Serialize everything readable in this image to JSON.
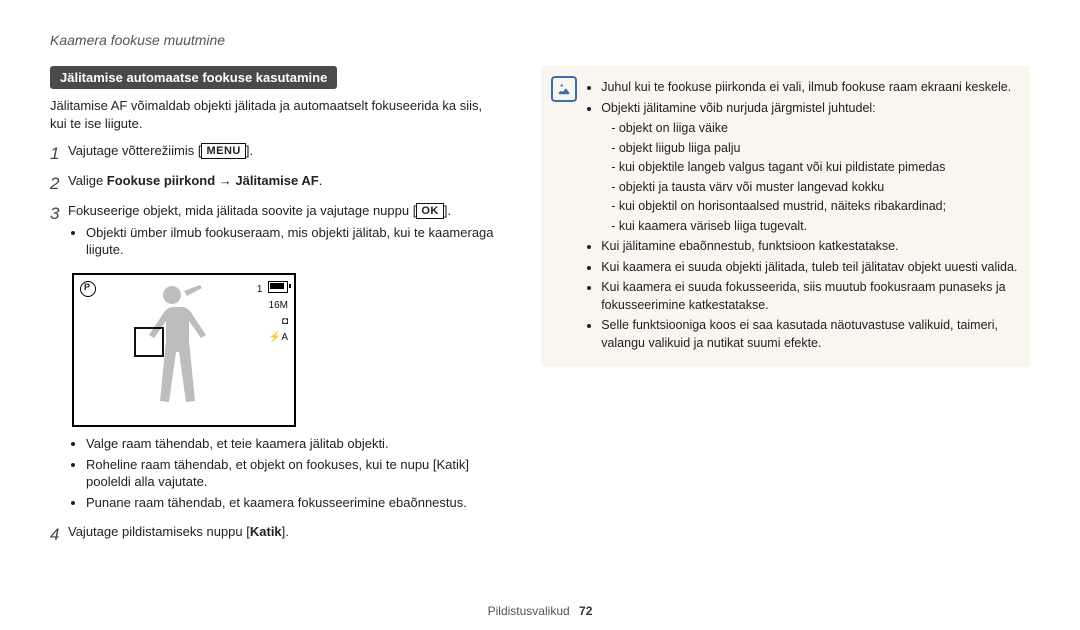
{
  "header": "Kaamera fookuse muutmine",
  "section_title": "Jälitamise automaatse fookuse kasutamine",
  "intro": "Jälitamise AF võimaldab objekti jälitada ja automaatselt fokuseerida ka siis, kui te ise liigute.",
  "steps": {
    "s1": {
      "num": "1",
      "text": "Vajutage võtterežiimis [",
      "key": "MENU",
      "after": "]."
    },
    "s2": {
      "num": "2",
      "before": "Valige ",
      "bold1": "Fookuse piirkond",
      "arrow": " → ",
      "bold2": "Jälitamise AF",
      "after": "."
    },
    "s3": {
      "num": "3",
      "text": "Fokuseerige objekt, mida jälitada soovite ja vajutage nuppu [",
      "key": "OK",
      "after": "].",
      "sub": [
        "Objekti ümber ilmub fookuseraam, mis objekti jälitab, kui te kaameraga liigute."
      ]
    },
    "s4": {
      "num": "4",
      "before": "Vajutage pildistamiseks nuppu [",
      "bold": "Katik",
      "after": "]."
    }
  },
  "screen_osd": {
    "shots": "1",
    "res": "16M",
    "icon3": "◘",
    "flash": "⚡A"
  },
  "notes_after_fig": [
    "Valge raam tähendab, et teie kaamera jälitab objekti.",
    "Roheline raam tähendab, et objekt on fookuses, kui te nupu [Katik] pooleldi alla vajutate.",
    "Punane raam tähendab, et kaamera fokusseerimine ebaõnnestus."
  ],
  "info": {
    "first": "Juhul kui te fookuse piirkonda ei vali, ilmub fookuse raam ekraani keskele.",
    "fail_intro": "Objekti jälitamine võib nurjuda järgmistel juhtudel:",
    "fail_list": [
      "objekt on liiga väike",
      "objekt liigub liiga palju",
      "kui objektile langeb valgus tagant või kui pildistate pimedas",
      "objekti ja tausta värv või muster langevad kokku",
      "kui objektil on horisontaalsed mustrid, näiteks ribakardinad;",
      "kui kaamera väriseb liiga tugevalt."
    ],
    "rest": [
      "Kui jälitamine ebaõnnestub, funktsioon katkestatakse.",
      "Kui kaamera ei suuda objekti jälitada, tuleb teil jälitatav objekt uuesti valida.",
      "Kui kaamera ei suuda fokusseerida, siis muutub fookusraam punaseks ja fokusseerimine katkestatakse.",
      "Selle funktsiooniga koos ei saa kasutada näotuvastuse valikuid, taimeri, valangu valikuid ja nutikat suumi efekte."
    ]
  },
  "footer": {
    "section": "Pildistusvalikud",
    "page": "72"
  }
}
